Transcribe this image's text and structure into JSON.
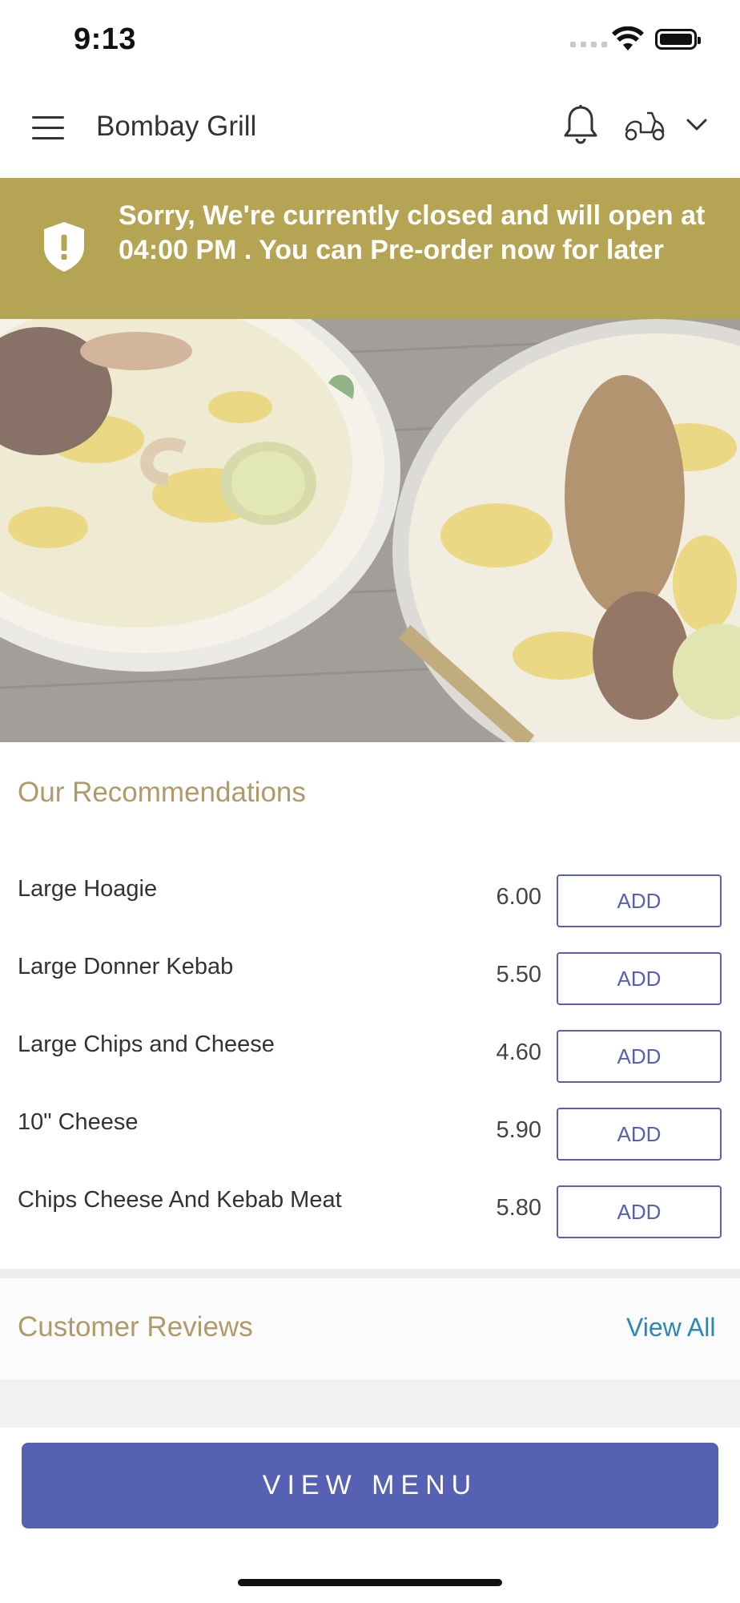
{
  "status_bar": {
    "time": "9:13"
  },
  "header": {
    "title": "Bombay Grill"
  },
  "notice": {
    "text": "Sorry, We're currently closed and will open at 04:00 PM . You can Pre-order now for later"
  },
  "recommendations": {
    "title": "Our Recommendations",
    "add_label": "ADD",
    "items": [
      {
        "name": "Large Hoagie",
        "price": "6.00"
      },
      {
        "name": "Large Donner Kebab",
        "price": "5.50"
      },
      {
        "name": "Large Chips and Cheese",
        "price": "4.60"
      },
      {
        "name": "10\" Cheese",
        "price": "5.90"
      },
      {
        "name": "Chips Cheese And Kebab Meat",
        "price": "5.80"
      }
    ]
  },
  "reviews": {
    "title": "Customer Reviews",
    "view_all": "View All"
  },
  "footer": {
    "view_menu": "VIEW MENU"
  },
  "icons": [
    "menu-icon",
    "bell-icon",
    "scooter-icon",
    "chevron-down-icon",
    "shield-alert-icon"
  ],
  "colors": {
    "banner": "#b5a453",
    "accent": "#5661b3",
    "section_title": "#b09a6a",
    "link": "#2c87b8"
  }
}
